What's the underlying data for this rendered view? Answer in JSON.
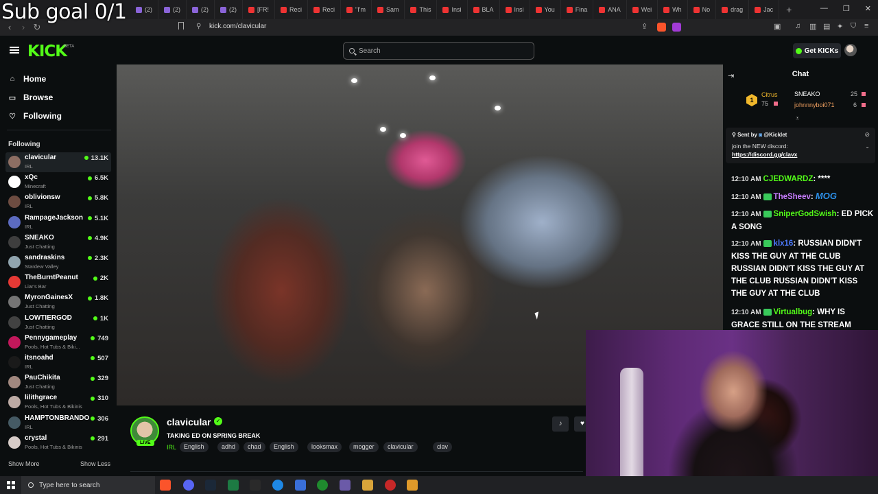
{
  "overlay": {
    "sub_goal": "Sub goal 0/1"
  },
  "browser": {
    "tabs": [
      {
        "label": "(2)"
      },
      {
        "label": "(2)"
      },
      {
        "label": "(2)"
      },
      {
        "label": "(2)"
      },
      {
        "label": "[FR!"
      },
      {
        "label": "Reci"
      },
      {
        "label": "Reci"
      },
      {
        "label": "\"I'm"
      },
      {
        "label": "Sam"
      },
      {
        "label": "This"
      },
      {
        "label": "Insi"
      },
      {
        "label": "BLA"
      },
      {
        "label": "Insi"
      },
      {
        "label": "You"
      },
      {
        "label": "Fina"
      },
      {
        "label": "ANA"
      },
      {
        "label": "Wei"
      },
      {
        "label": "Wh"
      },
      {
        "label": "No"
      },
      {
        "label": "drag"
      },
      {
        "label": "Jac"
      }
    ],
    "new_tab": "+",
    "url": "kick.com/clavicular"
  },
  "header": {
    "logo": "KICK",
    "beta": "BETA",
    "search_placeholder": "Search",
    "get_kicks": "Get KICKs"
  },
  "sidebar": {
    "nav": [
      {
        "label": "Home",
        "icon": "home-icon"
      },
      {
        "label": "Browse",
        "icon": "browse-icon"
      },
      {
        "label": "Following",
        "icon": "heart-icon"
      }
    ],
    "following_heading": "Following",
    "channels": [
      {
        "name": "clavicular",
        "category": "IRL",
        "viewers": "13.1K",
        "color": "#8d6e63"
      },
      {
        "name": "xQc",
        "category": "Minecraft",
        "viewers": "6.5K",
        "color": "#ffffff"
      },
      {
        "name": "oblivionsw",
        "category": "IRL",
        "viewers": "5.8K",
        "color": "#6d4c41"
      },
      {
        "name": "RampageJackson",
        "category": "IRL",
        "viewers": "5.1K",
        "color": "#5c6bc0"
      },
      {
        "name": "SNEAKO",
        "category": "Just Chatting",
        "viewers": "4.9K",
        "color": "#3e3e3e"
      },
      {
        "name": "sandraskins",
        "category": "Stardew Valley",
        "viewers": "2.3K",
        "color": "#90a4ae"
      },
      {
        "name": "TheBurntPeanut",
        "category": "Liar's Bar",
        "viewers": "2K",
        "color": "#e53935"
      },
      {
        "name": "MyronGainesX",
        "category": "Just Chatting",
        "viewers": "1.8K",
        "color": "#757575"
      },
      {
        "name": "LOWTIERGOD",
        "category": "Just Chatting",
        "viewers": "1K",
        "color": "#424242"
      },
      {
        "name": "Pennygameplay",
        "category": "Pools, Hot Tubs & Biki...",
        "viewers": "749",
        "color": "#c2185b"
      },
      {
        "name": "itsnoahd",
        "category": "IRL",
        "viewers": "507",
        "color": "#1a1a1a"
      },
      {
        "name": "PauChikita",
        "category": "Just Chatting",
        "viewers": "329",
        "color": "#a1887f"
      },
      {
        "name": "lilithgrace",
        "category": "Pools, Hot Tubs & Bikinis",
        "viewers": "310",
        "color": "#bcaaa4"
      },
      {
        "name": "HAMPTONBRANDO",
        "category": "IRL",
        "viewers": "306",
        "color": "#455a64"
      },
      {
        "name": "crystal",
        "category": "Pools, Hot Tubs & Bikinis",
        "viewers": "291",
        "color": "#d7ccc8"
      }
    ],
    "show_more": "Show More",
    "show_less": "Show Less"
  },
  "channel": {
    "name": "clavicular",
    "live": "LIVE",
    "title": "TAKING ED ON SPRING BREAK",
    "category": "IRL",
    "tags": [
      "English",
      "adhd",
      "chad",
      "English",
      "looksmax",
      "mogger",
      "clavicular",
      "clav"
    ]
  },
  "chat": {
    "title": "Chat",
    "top_gifters": {
      "rank": "1",
      "first": {
        "name": "Citrus",
        "count": "75"
      },
      "second": {
        "name": "SNEAKO",
        "count": "25"
      },
      "third": {
        "name": "johnnnyboi071",
        "count": "6"
      }
    },
    "pinned": {
      "sent_by": "Sent by",
      "sender": "@Kicklet",
      "text": "join the NEW discord:",
      "link": "https://discord.gg/clavx"
    },
    "messages": [
      {
        "time": "12:10 AM",
        "user": "CJEDWARDZ",
        "color": "#53fc18",
        "text": "****"
      },
      {
        "time": "12:10 AM",
        "user": "TheSheev",
        "color": "#c77dff",
        "text": "MOG"
      },
      {
        "time": "12:10 AM",
        "user": "SniperGodSwish",
        "color": "#53fc18",
        "text": "ED PICK A SONG"
      },
      {
        "time": "12:10 AM",
        "user": "klx16",
        "color": "#4e7bff",
        "text": "RUSSIAN DIDN'T KISS THE GUY AT THE CLUB RUSSIAN DIDN'T KISS THE GUY AT THE CLUB RUSSIAN DIDN'T KISS THE GUY AT THE CLUB"
      },
      {
        "time": "12:10 AM",
        "user": "Virtualbug",
        "color": "#53fc18",
        "text": "WHY IS GRACE STILL ON THE STREAM"
      }
    ]
  },
  "taskbar": {
    "search_placeholder": "Type here to search"
  },
  "colors": {
    "accent": "#53fc18",
    "background": "#0b0e0f",
    "panel": "#24272c"
  }
}
